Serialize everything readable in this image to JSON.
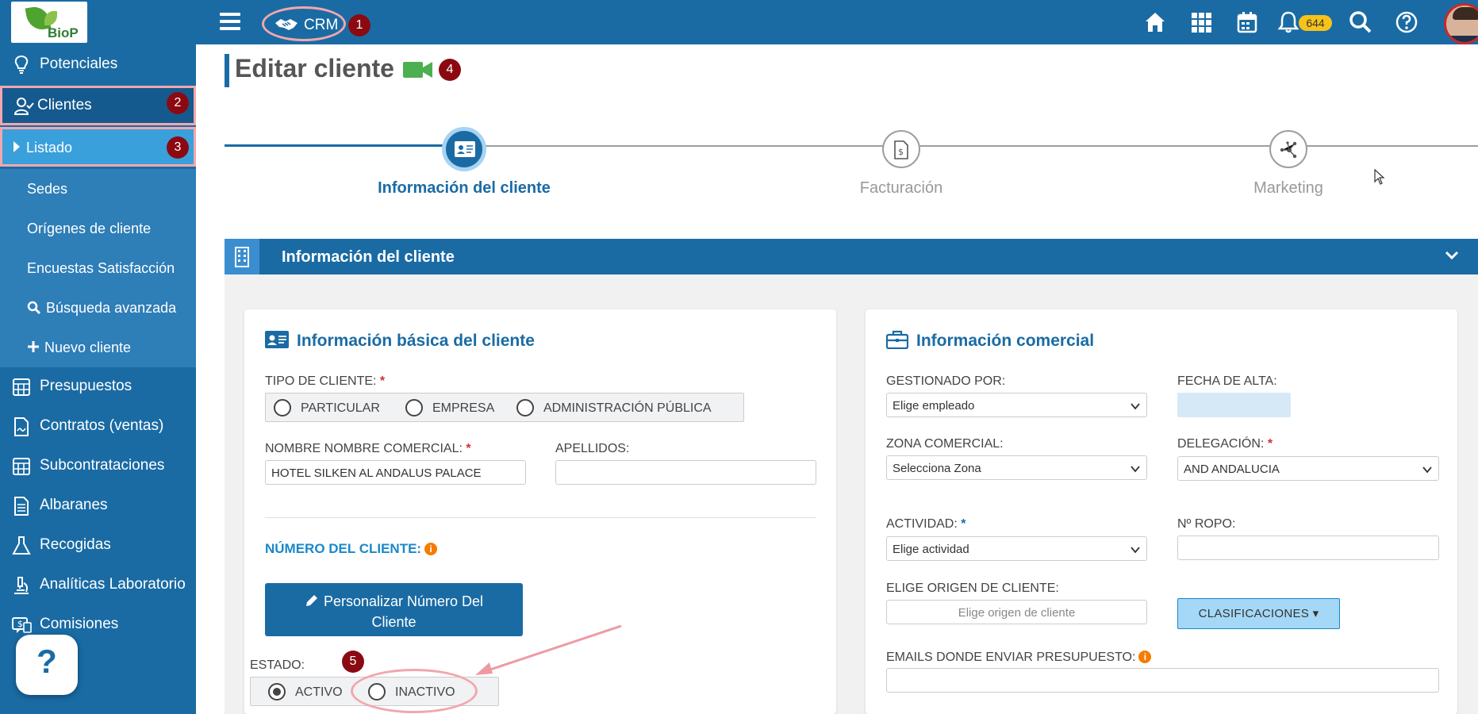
{
  "app": {
    "logo_text": "BioP",
    "crm_label": "CRM",
    "notification_count": "644"
  },
  "markers": [
    "1",
    "2",
    "3",
    "4",
    "5"
  ],
  "sidebar": {
    "items": [
      {
        "label": "Potenciales",
        "icon": "lightbulb-icon"
      },
      {
        "label": "Clientes",
        "icon": "user-check-icon"
      },
      {
        "label": "Presupuestos",
        "icon": "calculator-icon"
      },
      {
        "label": "Contratos (ventas)",
        "icon": "contract-icon"
      },
      {
        "label": "Subcontrataciones",
        "icon": "calculator-icon"
      },
      {
        "label": "Albaranes",
        "icon": "document-icon"
      },
      {
        "label": "Recogidas",
        "icon": "flask-icon"
      },
      {
        "label": "Analíticas Laboratorio",
        "icon": "microscope-icon"
      },
      {
        "label": "Comisiones",
        "icon": "commission-icon"
      }
    ],
    "subitems": [
      {
        "label": "Listado"
      },
      {
        "label": "Sedes"
      },
      {
        "label": "Orígenes de cliente"
      },
      {
        "label": "Encuestas Satisfacción"
      },
      {
        "label": "Búsqueda avanzada"
      },
      {
        "label": "Nuevo cliente"
      }
    ],
    "help_label": "?"
  },
  "page": {
    "title": "Editar cliente"
  },
  "stepper": {
    "steps": [
      {
        "label": "Información del cliente",
        "active": true
      },
      {
        "label": "Facturación",
        "active": false
      },
      {
        "label": "Marketing",
        "active": false
      }
    ]
  },
  "section": {
    "title": "Información del cliente"
  },
  "basic_info": {
    "title": "Información básica del cliente",
    "tipo_label": "TIPO DE CLIENTE:",
    "tipo_options": [
      "PARTICULAR",
      "EMPRESA",
      "ADMINISTRACIÓN PÚBLICA"
    ],
    "nombre_label": "NOMBRE NOMBRE COMERCIAL:",
    "nombre_value": "HOTEL SILKEN AL ANDALUS PALACE",
    "apellidos_label": "APELLIDOS:",
    "apellidos_value": "",
    "numero_label": "NÚMERO DEL CLIENTE:",
    "personalizar_label": "Personalizar Número Del Cliente",
    "estado_label": "ESTADO:",
    "estado_options": [
      "ACTIVO",
      "INACTIVO"
    ],
    "estado_selected": "ACTIVO"
  },
  "commercial_info": {
    "title": "Información comercial",
    "gestionado_label": "GESTIONADO POR:",
    "gestionado_value": "Elige empleado",
    "fecha_label": "FECHA DE ALTA:",
    "zona_label": "ZONA COMERCIAL:",
    "zona_value": "Selecciona Zona",
    "delegacion_label": "DELEGACIÓN:",
    "delegacion_value": "AND ANDALUCIA",
    "actividad_label": "ACTIVIDAD:",
    "actividad_value": "Elige actividad",
    "ropo_label": "Nº ROPO:",
    "origen_label": "ELIGE ORIGEN DE CLIENTE:",
    "origen_placeholder": "Elige origen de cliente",
    "clasificaciones_label": "CLASIFICACIONES",
    "emails_label": "EMAILS DONDE ENVIAR PRESUPUESTO:"
  },
  "colors": {
    "primary": "#1a6ba4",
    "highlight_ring": "#f1a7ad",
    "marker": "#8b0a12",
    "badge": "#f7c31a"
  }
}
